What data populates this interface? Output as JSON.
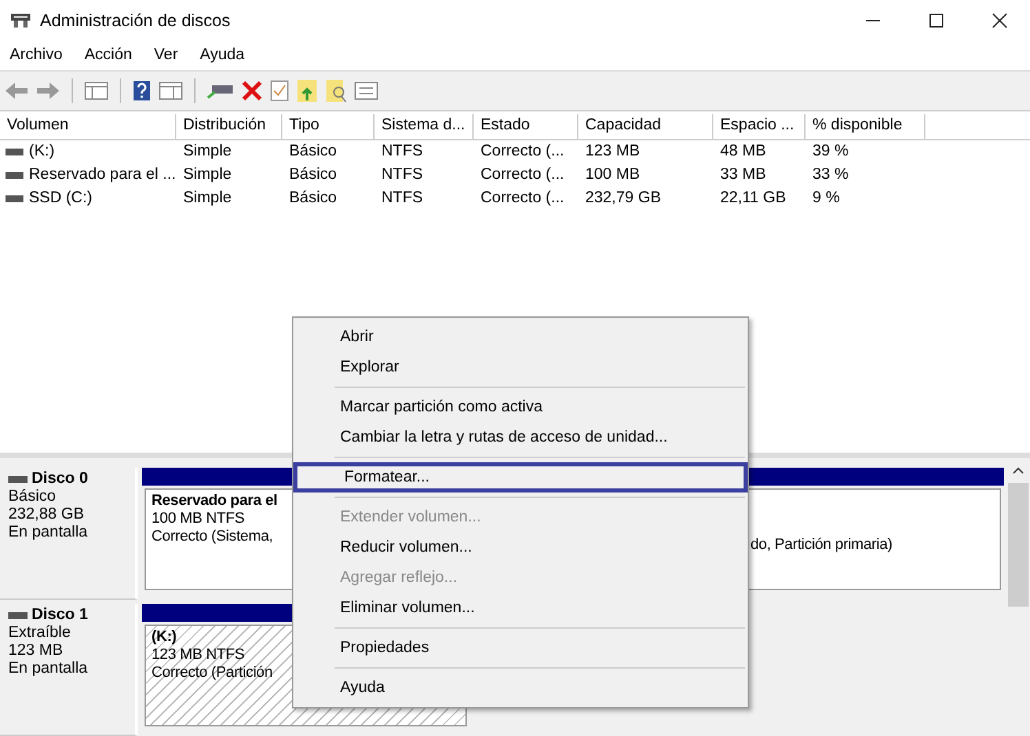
{
  "window": {
    "title": "Administración de discos"
  },
  "menu_bar": [
    "Archivo",
    "Acción",
    "Ver",
    "Ayuda"
  ],
  "volume_table": {
    "columns": [
      "Volumen",
      "Distribución",
      "Tipo",
      "Sistema d...",
      "Estado",
      "Capacidad",
      "Espacio ...",
      "% disponible"
    ],
    "rows": [
      {
        "cells": [
          "(K:)",
          "Simple",
          "Básico",
          "NTFS",
          "Correcto (...",
          "123 MB",
          "48 MB",
          "39 %"
        ]
      },
      {
        "cells": [
          "Reservado para el ...",
          "Simple",
          "Básico",
          "NTFS",
          "Correcto (...",
          "100 MB",
          "33 MB",
          "33 %"
        ]
      },
      {
        "cells": [
          "SSD (C:)",
          "Simple",
          "Básico",
          "NTFS",
          "Correcto (...",
          "232,79 GB",
          "22,11 GB",
          "9 %"
        ]
      }
    ]
  },
  "disks": [
    {
      "name": "Disco 0",
      "type": "Básico",
      "size": "232,88 GB",
      "status": "En pantalla",
      "partitions": [
        {
          "kind": "plain",
          "title": "Reservado para el",
          "detail": "100 MB NTFS",
          "status": "Correcto (Sistema,"
        },
        {
          "kind": "plain",
          "status": "do, Partición primaria)"
        }
      ]
    },
    {
      "name": "Disco 1",
      "type": "Extraíble",
      "size": "123 MB",
      "status": "En pantalla",
      "partitions": [
        {
          "kind": "hatched",
          "title": "(K:)",
          "detail": "123 MB NTFS",
          "status": "Correcto (Partición"
        }
      ]
    }
  ],
  "context_menu": {
    "sections": [
      [
        {
          "label": "Abrir",
          "disabled": false,
          "highlighted": false
        },
        {
          "label": "Explorar",
          "disabled": false,
          "highlighted": false
        }
      ],
      [
        {
          "label": "Marcar partición como activa",
          "disabled": false,
          "highlighted": false
        },
        {
          "label": "Cambiar la letra y rutas de acceso de unidad...",
          "disabled": false,
          "highlighted": false
        }
      ],
      [
        {
          "label": "Formatear...",
          "disabled": false,
          "highlighted": true
        }
      ],
      [
        {
          "label": "Extender volumen...",
          "disabled": true,
          "highlighted": false
        },
        {
          "label": "Reducir volumen...",
          "disabled": false,
          "highlighted": false
        },
        {
          "label": "Agregar reflejo...",
          "disabled": true,
          "highlighted": false
        },
        {
          "label": "Eliminar volumen...",
          "disabled": false,
          "highlighted": false
        }
      ],
      [
        {
          "label": "Propiedades",
          "disabled": false,
          "highlighted": false
        }
      ],
      [
        {
          "label": "Ayuda",
          "disabled": false,
          "highlighted": false
        }
      ]
    ]
  }
}
